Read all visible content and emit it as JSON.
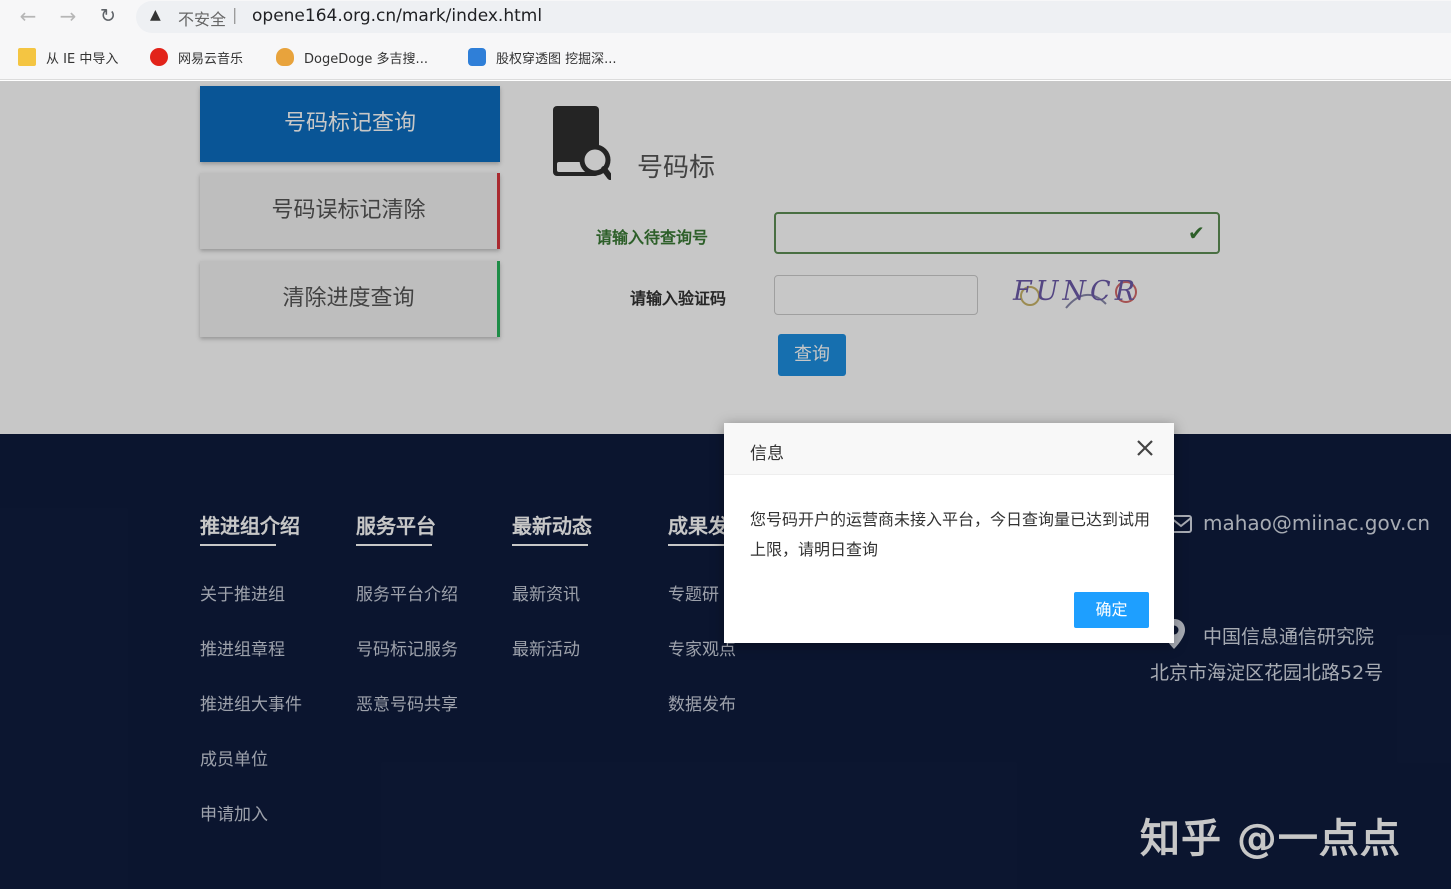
{
  "browser": {
    "security_label": "不安全",
    "address_separator": "|",
    "url": "opene164.org.cn/mark/index.html",
    "bookmarks": [
      {
        "label": "从 IE 中导入"
      },
      {
        "label": "网易云音乐"
      },
      {
        "label": "DogeDoge 多吉搜..."
      },
      {
        "label": "股权穿透图 挖掘深..."
      }
    ]
  },
  "sidebar": {
    "items": [
      {
        "label": "号码标记查询",
        "active": true
      },
      {
        "label": "号码误标记清除"
      },
      {
        "label": "清除进度查询"
      }
    ]
  },
  "form": {
    "section_title": "号码标",
    "phone_label": "请输入待查询号",
    "phone_value": "",
    "captcha_label": "请输入验证码",
    "captcha_value": "",
    "captcha_text": "FUNCR",
    "submit_label": "查询"
  },
  "footer": {
    "columns": [
      {
        "heading": "推进组介绍",
        "links": [
          "关于推进组",
          "推进组章程",
          "推进组大事件",
          "成员单位",
          "申请加入"
        ]
      },
      {
        "heading": "服务平台",
        "links": [
          "服务平台介绍",
          "号码标记服务",
          "恶意号码共享"
        ]
      },
      {
        "heading": "最新动态",
        "links": [
          "最新资讯",
          "最新活动"
        ]
      },
      {
        "heading": "成果发",
        "links": [
          "专题研",
          "专家观点",
          "数据发布"
        ]
      }
    ],
    "contact": {
      "email": "mahao@miinac.gov.cn",
      "org": "中国信息通信研究院",
      "address": "北京市海淀区花园北路52号"
    },
    "watermark": "知乎 @一点点"
  },
  "modal": {
    "title": "信息",
    "message": "您号码开户的运营商未接入平台，今日查询量已达到试用上限，请明日查询",
    "confirm_label": "确定"
  },
  "colors": {
    "primary_blue": "#0c6ec0",
    "footer_bg": "#0f1c3d",
    "dialog_button": "#1e9fff",
    "valid_green": "#3a7a35"
  }
}
